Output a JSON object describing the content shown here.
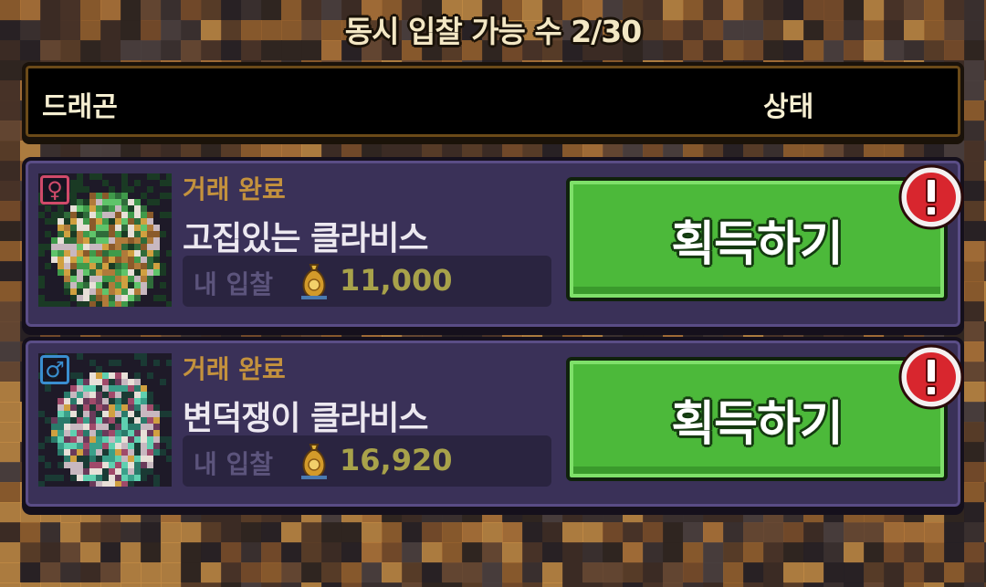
{
  "header": {
    "title": "동시 입찰 가능 수 2/30",
    "col_dragon": "드래곤",
    "col_status": "상태"
  },
  "rows": [
    {
      "gender": "female",
      "gender_symbol": "♀",
      "gender_color": "#d04a6a",
      "status": "거래 완료",
      "name": "고집있는 클라비스",
      "bid_label": "내 입찰",
      "bid_amount": "11,000",
      "action_label": "획득하기",
      "alert_icon": "exclamation-alert-icon"
    },
    {
      "gender": "male",
      "gender_symbol": "♂",
      "gender_color": "#3a8ed0",
      "status": "거래 완료",
      "name": "변덕쟁이 클라비스",
      "bid_label": "내 입찰",
      "bid_amount": "16,920",
      "action_label": "획득하기",
      "alert_icon": "exclamation-alert-icon"
    }
  ],
  "colors": {
    "status_text": "#c4923d",
    "button_green": "#4cb93a",
    "alert_red": "#d8262e",
    "row_bg": "#3a3158"
  }
}
